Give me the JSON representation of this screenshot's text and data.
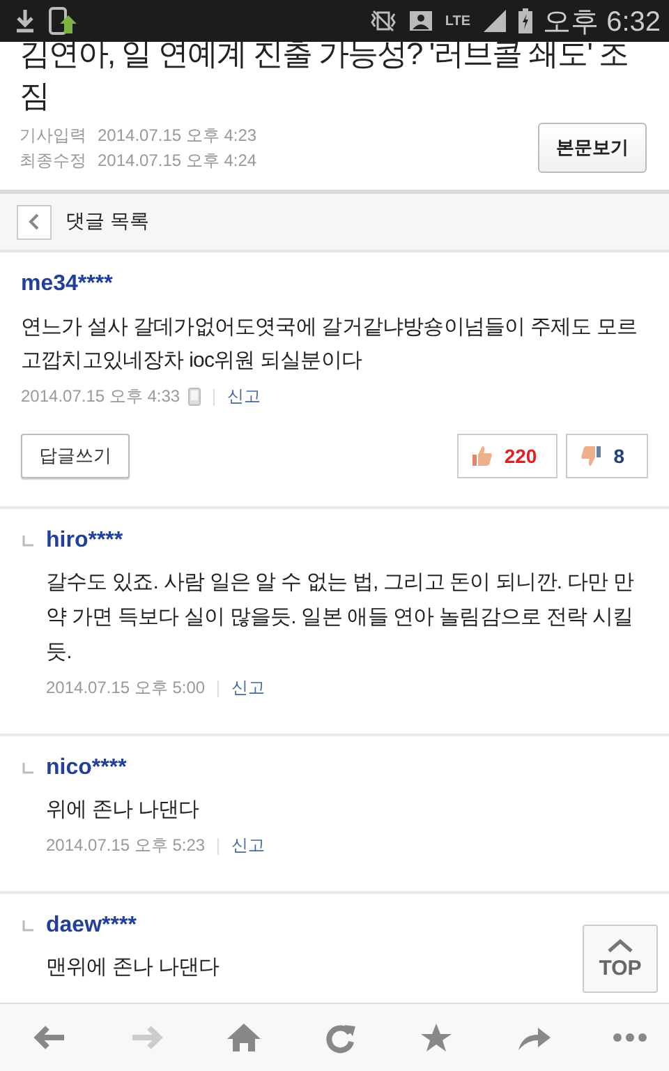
{
  "status_bar": {
    "network": "LTE",
    "time": "오후 6:32",
    "charging": true
  },
  "article": {
    "title": "김연아, 일 연예계 진출 가능성? '러브콜 쇄도' 조짐",
    "meta": [
      {
        "label": "기사입력",
        "value": "2014.07.15 오후 4:23"
      },
      {
        "label": "최종수정",
        "value": "2014.07.15 오후 4:24"
      }
    ],
    "view_button": "본문보기"
  },
  "comment_header": {
    "title": "댓글 목록"
  },
  "comments": [
    {
      "kind": "comment",
      "user": "me34****",
      "text": "연느가 설사 갈데가없어도엿국에 갈거같냐방숑이넘들이 주제도 모르고깝치고있네장차 ioc위원 되실분이다",
      "date": "2014.07.15 오후 4:33",
      "mobile": true,
      "report": "신고",
      "reply_button": "답글쓰기",
      "likes": "220",
      "dislikes": "8"
    },
    {
      "kind": "reply",
      "user": "hiro****",
      "text": "갈수도 있죠. 사람 일은 알 수 없는 법, 그리고 돈이 되니깐. 다만 만약 가면 득보다 실이 많을듯. 일본 애들 연아 놀림감으로 전락 시킬듯.",
      "date": "2014.07.15 오후 5:00",
      "mobile": false,
      "report": "신고"
    },
    {
      "kind": "reply",
      "user": "nico****",
      "text": "위에 존나 나댄다",
      "date": "2014.07.15 오후 5:23",
      "mobile": false,
      "report": "신고"
    },
    {
      "kind": "reply",
      "user": "daew****",
      "text": "맨위에 존나 나댄다"
    }
  ],
  "top_button": "TOP",
  "nav": [
    {
      "kind": "back",
      "disabled": false
    },
    {
      "kind": "forward",
      "disabled": true
    },
    {
      "kind": "home",
      "disabled": false
    },
    {
      "kind": "reload",
      "disabled": false
    },
    {
      "kind": "bookmark",
      "disabled": false
    },
    {
      "kind": "share",
      "disabled": false
    },
    {
      "kind": "more",
      "disabled": false
    }
  ]
}
